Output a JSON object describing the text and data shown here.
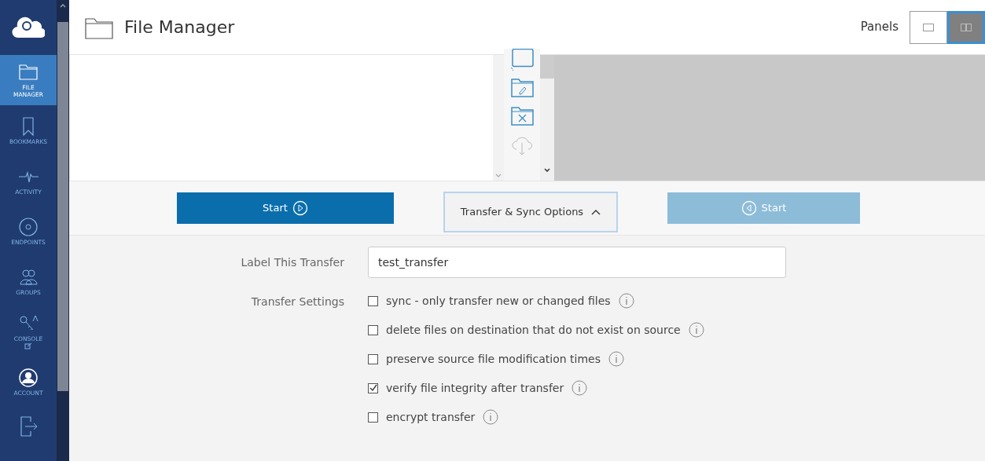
{
  "sidebar": {
    "items": [
      {
        "kind": "folder",
        "label": "FILE\nMANAGER",
        "selected": true
      },
      {
        "kind": "bookmark",
        "label": "BOOKMARKS",
        "selected": false
      },
      {
        "kind": "activity",
        "label": "ACTIVITY",
        "selected": false
      },
      {
        "kind": "endpoint",
        "label": "ENDPOINTS",
        "selected": false
      },
      {
        "kind": "groups",
        "label": "GROUPS",
        "selected": false
      },
      {
        "kind": "console",
        "label": "CONSOLE",
        "selected": false
      },
      {
        "kind": "account",
        "label": "ACCOUNT",
        "selected": false
      },
      {
        "kind": "logout",
        "selected": false
      }
    ]
  },
  "header": {
    "title": "File Manager",
    "panels_label": "Panels",
    "panels": [
      {
        "kind": "single",
        "selected": false
      },
      {
        "kind": "double",
        "selected": true
      }
    ]
  },
  "toolbar": [
    {
      "kind": "new-folder",
      "disabled": false
    },
    {
      "kind": "rename",
      "disabled": false
    },
    {
      "kind": "delete",
      "disabled": false
    },
    {
      "kind": "download",
      "disabled": true
    }
  ],
  "actions": {
    "start_left": {
      "label": "Start",
      "disabled": false
    },
    "options": {
      "label": "Transfer & Sync Options",
      "expanded": true
    },
    "start_right": {
      "label": "Start",
      "disabled": true
    }
  },
  "form": {
    "label_field": {
      "label": "Label This Transfer",
      "value": "test_transfer"
    },
    "settings_label": "Transfer Settings",
    "settings": [
      {
        "label": "sync - only transfer new or changed files",
        "checked": false
      },
      {
        "label": "delete files on destination that do not exist on source",
        "checked": false
      },
      {
        "label": "preserve source file modification times",
        "checked": false
      },
      {
        "label": "verify file integrity after transfer",
        "checked": true
      },
      {
        "label": "encrypt transfer",
        "checked": false
      }
    ]
  }
}
